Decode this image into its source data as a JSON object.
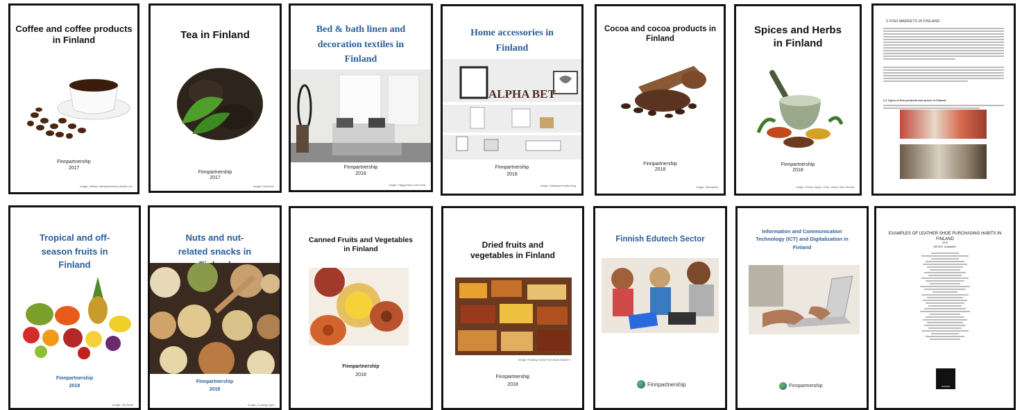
{
  "covers": [
    {
      "title": "Coffee and coffee products in Finland",
      "publisher": "Finnpartnership",
      "year": "2017",
      "credit": "Image: William Warby/Business Media Ltd"
    },
    {
      "title": "Tea in Finland",
      "publisher": "Finnpartnership",
      "year": "2017",
      "credit": "Image: iStock/AJ"
    },
    {
      "title": "Bed & bath linen and decoration textiles in Finland",
      "publisher": "Finnpartnership",
      "year": "2018",
      "credit": "Image: Happy/Very Lush blog"
    },
    {
      "title": "Home accessories in Finland",
      "publisher": "Finnpartnership",
      "year": "2018",
      "credit": "Image: Wallpaper/Joyfly blog",
      "photo_letters": "ALPHA BET"
    },
    {
      "title": "Cocoa and cocoa products in Finland",
      "publisher": "Finnpartnership",
      "year": "2018",
      "credit": "Image: lebedynka"
    },
    {
      "title": "Spices and Herbs in Finland",
      "publisher": "Finnpartnership",
      "year": "2018",
      "credit": "Image: Sanny Japps / Pots, album Vald Struste"
    },
    {
      "heading": "2  FISH MARKETS IN FINLAND",
      "subheading": "2.1 Types of fish products and prices in Finland"
    },
    {
      "title": "Tropical and off-season fruits in Finland",
      "publisher": "Finnpartnership",
      "year": "2018",
      "credit": "Image: Val Zeale"
    },
    {
      "title": "Nuts and nut-related snacks in Finland",
      "publisher": "Finnpartnership",
      "year": "2018",
      "credit": "Image: Cooking Light"
    },
    {
      "title": "Canned Fruits and Vegetables in Finland",
      "publisher": "Finnpartnership",
      "year": "2018"
    },
    {
      "title": "Dried fruits and vegetables in Finland",
      "publisher": "Finnpartnership",
      "year": "2018",
      "credit": "Image: Pixabay, Dried Fruit Stock Market 1"
    },
    {
      "title": "Finnish Edutech Sector",
      "logo_text": "Finnpartnership"
    },
    {
      "title": "Information and Communication Technology (ICT) and Digitalization in Finland",
      "logo_text": "Finnpartnership"
    },
    {
      "title": "EXAMPLES OF LEATHER SHOE PURCHASING HABITS IN FINLAND",
      "year": "2018",
      "summary": "REPORT SUMMARY",
      "logo_text": "HANKEN"
    }
  ],
  "colors": {
    "title_blue": "#2a5e98",
    "border": "#111111",
    "finnpartnership_green": "#2e8b3e"
  }
}
